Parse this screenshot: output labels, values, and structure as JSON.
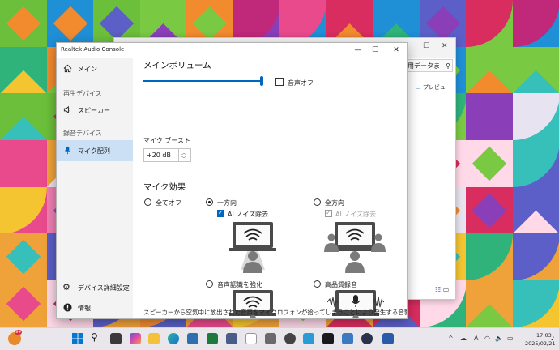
{
  "window": {
    "title": "Realtek Audio Console",
    "minimize_symbol": "—",
    "maximize_symbol": "☐",
    "close_symbol": "✕"
  },
  "background_window": {
    "search_text": "用データま",
    "preview_label": "プレビュー",
    "close_symbol": "✕",
    "maximize_symbol": "☐"
  },
  "sidebar": {
    "home_label": "メイン",
    "playback_group": "再生デバイス",
    "speaker_label": "スピーカー",
    "record_group": "録音デバイス",
    "mic_label": "マイク配列",
    "device_settings_label": "デバイス詳細設定",
    "info_label": "情報"
  },
  "main": {
    "volume_title": "メインボリューム",
    "volume_level": 0.97,
    "mute_label": "音声オフ",
    "mute_checked": false,
    "boost_title": "マイク ブースト",
    "boost_value": "+20 dB",
    "effects_title": "マイク効果",
    "options": [
      {
        "label": "全てオフ",
        "selected": false
      },
      {
        "label": "一方向",
        "selected": true
      },
      {
        "label": "全方向",
        "selected": false
      },
      {
        "label": "音声認識を強化",
        "selected": false
      },
      {
        "label": "高品質録音",
        "selected": false
      }
    ],
    "noise_one": {
      "label": "AI ノイズ除去",
      "checked": true,
      "enabled": true
    },
    "noise_all": {
      "label": "AI ノイズ除去",
      "checked": true,
      "enabled": false
    },
    "footer": "スピーカーから空気中に放出された音声をマイクロフォンが拾ってしまうことにより発生する音響エコーをAEC"
  },
  "taskbar": {
    "badge": "9+",
    "time": "17:03",
    "date": "2025/02/21",
    "ime": "A"
  },
  "colors": {
    "accent": "#0067c0",
    "sidebar_bg": "#f3f3f3",
    "active_nav": "#cce0f5"
  }
}
